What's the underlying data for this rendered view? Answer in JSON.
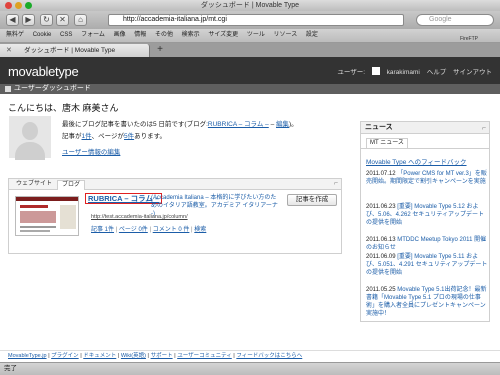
{
  "window": {
    "title": "ダッシュボード | Movable Type"
  },
  "toolbar": {
    "url": "http://accademia-italiana.jp/mt.cgi",
    "search_placeholder": "Google"
  },
  "bookmarks": [
    "無料ゲ",
    "Cookie",
    "CSS",
    "フォーム",
    "画像",
    "情報",
    "その他",
    "検索示",
    "サイズ変更",
    "ツール",
    "リソース",
    "設定"
  ],
  "bookmark_extra": "FireFTP",
  "tab": {
    "label": "ダッシュボード | Movable Type"
  },
  "mt_header": {
    "logo": "movabletype",
    "user_label": "ユーザー:",
    "username": "karakimami",
    "help": "ヘルプ",
    "signout": "サインアウト"
  },
  "dashbar": {
    "title": "ユーザーダッシュボード"
  },
  "main": {
    "greeting": "こんにちは、唐木 麻美さん",
    "last_post_prefix": "最後にブログ記事を書いたのは5 日前です(ブログ:",
    "last_post_blog": "RUBRICA – コラム –",
    "last_post_sep": " – ",
    "last_post_edit": "編集",
    "last_post_suffix": ")。",
    "stats_prefix": "記事が",
    "stats_entries": "1件",
    "stats_mid": "、ページが",
    "stats_pages": "5件",
    "stats_suffix": "あります。",
    "profile_link": "ユーザー情報の編集"
  },
  "blog_widget": {
    "tabs": [
      "ウェブサイト",
      "ブログ"
    ],
    "blog_title": "RUBRICA – コラム –",
    "blog_desc": "(Accademia Italiana – 本格的に学びたい方のためのイタリア語教室。アカデミア イタリアーナ -)",
    "blog_url": "http://test.accademia-italiana.jp/column/",
    "actions": [
      "記事 1件",
      "ページ 0件",
      "コメント 0 件",
      "検索"
    ],
    "new_entry": "記事を作成"
  },
  "news_widget": {
    "title": "ニュース",
    "tab": "MT ニュース",
    "feedback": "Movable Type へのフィードバック",
    "items": [
      {
        "date": "2011.07.12",
        "text": "「Power CMS for MT ver.3」を販売開始。期間限定で割引キャンペーンを実施"
      },
      {
        "date": "2011.06.23",
        "text": "[重要] Movable Type 5.12 および、5.06、4.262 セキュリティアップデートの提供を開始"
      },
      {
        "date": "2011.06.13",
        "text": "MTDDC Meetup Tokyo 2011 開催のお知らせ"
      },
      {
        "date": "2011.06.09",
        "text": "[重要] Movable Type 5.11 および、5.051、4.291 セキュリティアップデートの提供を開始"
      },
      {
        "date": "2011.05.25",
        "text": "Movable Type 5.1出荷記念！最新書籍「Movable Type 5.1 プロの現場の仕事術」を購入者全員にプレゼントキャンペーン実施中！"
      }
    ]
  },
  "footer": {
    "links": [
      "MovableType.jp",
      "プラグイン",
      "ドキュメント",
      "Wiki(英語)",
      "サポート",
      "ユーザーコミュニティ",
      "フィードバックはこちらへ"
    ],
    "sep": "|"
  },
  "status": {
    "text": "完了"
  },
  "colors": {
    "header_bg": "#333333",
    "dashbar_bg": "#5f5f5f",
    "link": "#1b5da8",
    "highlight_border": "#e02020"
  }
}
